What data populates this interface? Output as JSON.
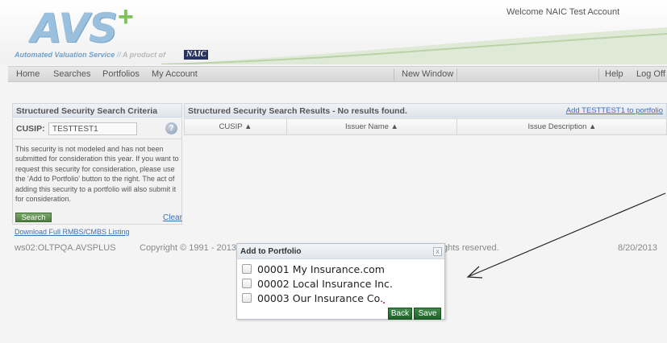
{
  "header": {
    "logo_text": "AVS",
    "logo_plus": "+",
    "tagline_main": "Automated Valuation Service",
    "tagline_sep": "//",
    "tagline_prod": "A product of",
    "naic_badge": "NAIC",
    "welcome": "Welcome NAIC Test Account"
  },
  "nav": {
    "home": "Home",
    "searches": "Searches",
    "portfolios": "Portfolios",
    "my_account": "My Account",
    "new_window": "New Window",
    "help": "Help",
    "log_off": "Log Off"
  },
  "search_criteria": {
    "header": "Structured Security Search Criteria",
    "cusip_label": "CUSIP:",
    "cusip_value": "TESTTEST1",
    "help_icon": "?",
    "info_text": "This security is not modeled and has not been submitted for consideration this year. If you want to request this security for consideration, please use the 'Add to Portfolio' button to the right. The act of adding this security to a portfolio will also submit it for consideration.",
    "search_button": "Search",
    "clear_link": "Clear",
    "download_link": "Download Full RMBS/CMBS Listing"
  },
  "results": {
    "title": "Structured Security Search Results - No results found.",
    "add_link": "Add TESTTEST1 to portfolio",
    "columns": [
      "CUSIP ▲",
      "Issuer Name ▲",
      "Issue Description ▲"
    ]
  },
  "footer": {
    "server": "ws02:OLTPQA.AVSPLUS",
    "copyright_left": "Copyright © 1991 - 2013. I",
    "copyright_right": "ghts reserved.",
    "date": "8/20/2013"
  },
  "dialog": {
    "title": "Add to Portfolio",
    "close_icon": "x",
    "portfolios": [
      {
        "label": "00001  My Insurance.com",
        "checked": false
      },
      {
        "label": "00002  Local Insurance Inc.",
        "checked": false
      },
      {
        "label": "00003  Our Insurance Co.",
        "checked": false
      }
    ],
    "back_button": "Back",
    "save_button": "Save"
  },
  "colors": {
    "link": "#3f6fb3",
    "button_green": "#4e7f40",
    "dialog_button_green": "#1e6227",
    "logo_blue": "#9bc0de",
    "logo_green": "#7cc35a"
  }
}
